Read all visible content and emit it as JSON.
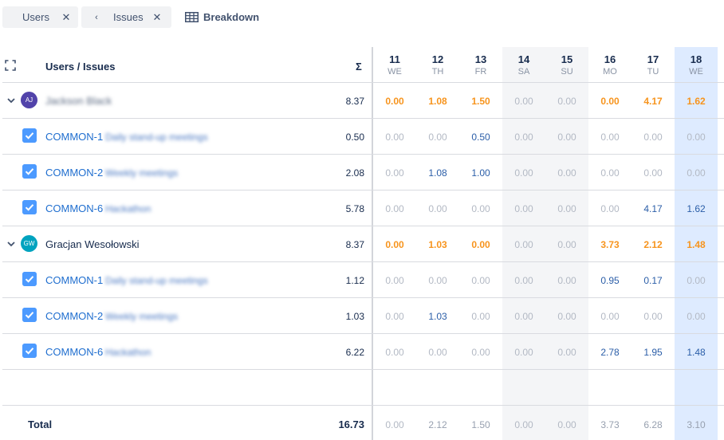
{
  "filters": {
    "chips": [
      {
        "label": "Users",
        "has_back": false
      },
      {
        "label": "Issues",
        "has_back": true
      }
    ],
    "breakdown_label": "Breakdown"
  },
  "table": {
    "header_title": "Users / Issues",
    "sum_symbol": "Σ",
    "days": [
      {
        "day": "11",
        "weekday": "WE",
        "type": "workday"
      },
      {
        "day": "12",
        "weekday": "TH",
        "type": "workday"
      },
      {
        "day": "13",
        "weekday": "FR",
        "type": "workday"
      },
      {
        "day": "14",
        "weekday": "SA",
        "type": "weekend"
      },
      {
        "day": "15",
        "weekday": "SU",
        "type": "weekend"
      },
      {
        "day": "16",
        "weekday": "MO",
        "type": "workday"
      },
      {
        "day": "17",
        "weekday": "TU",
        "type": "workday"
      },
      {
        "day": "18",
        "weekday": "WE",
        "type": "today"
      }
    ],
    "rows": [
      {
        "kind": "user",
        "initials": "AJ",
        "avatar_color": "#5243aa",
        "name": "Jackson Black",
        "name_blurred": true,
        "sum": "8.37",
        "values": [
          "0.00",
          "1.08",
          "1.50",
          "0.00",
          "0.00",
          "0.00",
          "4.17",
          "1.62"
        ]
      },
      {
        "kind": "issue",
        "key": "COMMON-1",
        "summary": "Daily stand-up meetings",
        "sum": "0.50",
        "values": [
          "0.00",
          "0.00",
          "0.50",
          "0.00",
          "0.00",
          "0.00",
          "0.00",
          "0.00"
        ]
      },
      {
        "kind": "issue",
        "key": "COMMON-2",
        "summary": "Weekly meetings",
        "sum": "2.08",
        "values": [
          "0.00",
          "1.08",
          "1.00",
          "0.00",
          "0.00",
          "0.00",
          "0.00",
          "0.00"
        ]
      },
      {
        "kind": "issue",
        "key": "COMMON-6",
        "summary": "Hackathon",
        "sum": "5.78",
        "values": [
          "0.00",
          "0.00",
          "0.00",
          "0.00",
          "0.00",
          "0.00",
          "4.17",
          "1.62"
        ]
      },
      {
        "kind": "user",
        "initials": "GW",
        "avatar_color": "#00a3bf",
        "name": "Gracjan Wesołowski",
        "name_blurred": false,
        "sum": "8.37",
        "values": [
          "0.00",
          "1.03",
          "0.00",
          "0.00",
          "0.00",
          "3.73",
          "2.12",
          "1.48"
        ]
      },
      {
        "kind": "issue",
        "key": "COMMON-1",
        "summary": "Daily stand-up meetings",
        "sum": "1.12",
        "values": [
          "0.00",
          "0.00",
          "0.00",
          "0.00",
          "0.00",
          "0.95",
          "0.17",
          "0.00"
        ]
      },
      {
        "kind": "issue",
        "key": "COMMON-2",
        "summary": "Weekly meetings",
        "sum": "1.03",
        "values": [
          "0.00",
          "1.03",
          "0.00",
          "0.00",
          "0.00",
          "0.00",
          "0.00",
          "0.00"
        ]
      },
      {
        "kind": "issue",
        "key": "COMMON-6",
        "summary": "Hackathon",
        "sum": "6.22",
        "values": [
          "0.00",
          "0.00",
          "0.00",
          "0.00",
          "0.00",
          "2.78",
          "1.95",
          "1.48"
        ]
      }
    ],
    "total": {
      "label": "Total",
      "sum": "16.73",
      "values": [
        "0.00",
        "2.12",
        "1.50",
        "0.00",
        "0.00",
        "3.73",
        "6.28",
        "3.10"
      ]
    }
  },
  "colors": {
    "orange": "#f7941d",
    "blue": "#2b5ea8",
    "weekend_bg": "#f4f5f7",
    "today_bg": "#deebff",
    "checkbox": "#4c9aff"
  }
}
